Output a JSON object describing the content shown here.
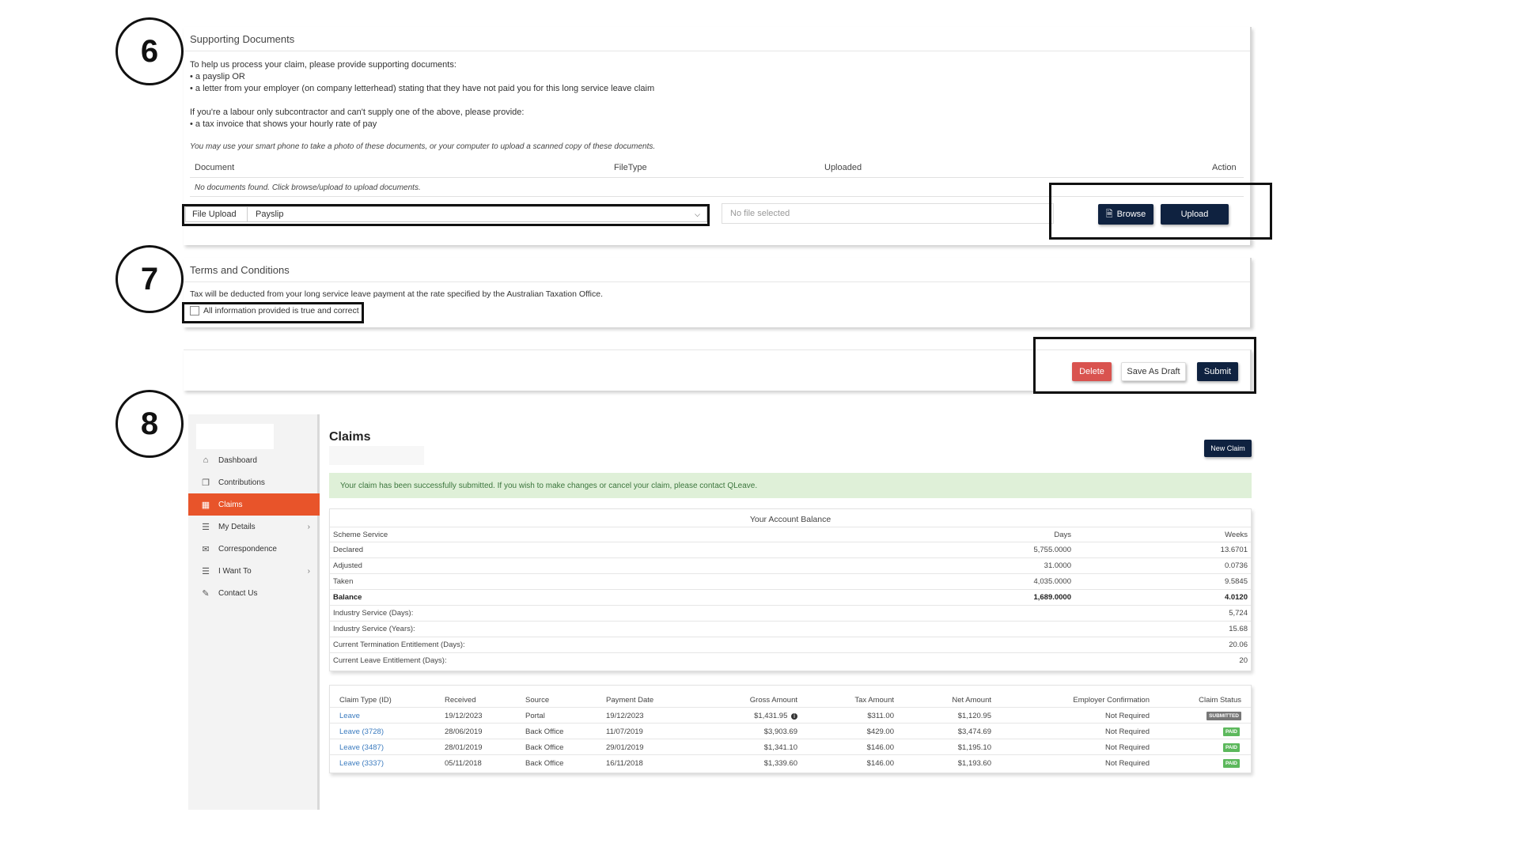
{
  "steps": [
    "6",
    "7",
    "8"
  ],
  "supporting_documents": {
    "title": "Supporting Documents",
    "intro": "To help us process your claim, please provide supporting documents:",
    "bullet1": "• a payslip OR",
    "bullet2": "• a letter from your employer (on company letterhead) stating that they have not paid you for this long service leave claim",
    "subcontractor": "If you're a labour only subcontractor and can't supply one of the above, please provide:",
    "bullet3": "• a tax invoice that shows your hourly rate of pay",
    "phone_note": "You may use your smart phone to take a photo of these documents, or your computer to upload a scanned copy of these documents.",
    "col_document": "Document",
    "col_filetype": "FileType",
    "col_uploaded": "Uploaded",
    "col_action": "Action",
    "empty": "No documents found. Click browse/upload to upload documents.",
    "file_upload_label": "File Upload",
    "file_type_selected": "Payslip",
    "no_file": "No file selected",
    "browse": "Browse",
    "upload": "Upload"
  },
  "terms": {
    "title": "Terms and Conditions",
    "text": "Tax will be deducted from your long service leave payment at the rate specified by the Australian Taxation Office.",
    "checkbox_label": "All information provided is true and correct"
  },
  "actions": {
    "delete": "Delete",
    "save_draft": "Save As Draft",
    "submit": "Submit"
  },
  "sidebar": {
    "items": [
      {
        "label": "Dashboard",
        "icon": "home-icon"
      },
      {
        "label": "Contributions",
        "icon": "copy-icon"
      },
      {
        "label": "Claims",
        "icon": "claims-icon"
      },
      {
        "label": "My Details",
        "icon": "list-icon"
      },
      {
        "label": "Correspondence",
        "icon": "envelope-icon"
      },
      {
        "label": "I Want To",
        "icon": "list-icon"
      },
      {
        "label": "Contact Us",
        "icon": "pencil-icon"
      }
    ]
  },
  "claims_page": {
    "title": "Claims",
    "new_claim": "New Claim",
    "success": "Your claim has been successfully submitted. If you wish to make changes or cancel your claim, please contact QLeave."
  },
  "balance": {
    "title": "Your Account Balance",
    "header": {
      "label": "Scheme Service",
      "days": "Days",
      "weeks": "Weeks"
    },
    "rows": [
      {
        "label": "Declared",
        "days": "5,755.0000",
        "weeks": "13.6701"
      },
      {
        "label": "Adjusted",
        "days": "31.0000",
        "weeks": "0.0736"
      },
      {
        "label": "Taken",
        "days": "4,035.0000",
        "weeks": "9.5845"
      },
      {
        "label": "Balance",
        "days": "1,689.0000",
        "weeks": "4.0120"
      }
    ],
    "extra": [
      {
        "label": "Industry Service (Days):",
        "value": "5,724"
      },
      {
        "label": "Industry Service (Years):",
        "value": "15.68"
      },
      {
        "label": "Current Termination Entitlement (Days):",
        "value": "20.06"
      },
      {
        "label": "Current Leave Entitlement (Days):",
        "value": "20"
      }
    ]
  },
  "claims_table": {
    "headers": {
      "type": "Claim Type (ID)",
      "received": "Received",
      "source": "Source",
      "payment": "Payment Date",
      "gross": "Gross Amount",
      "tax": "Tax Amount",
      "net": "Net Amount",
      "employer": "Employer Confirmation",
      "status": "Claim Status"
    },
    "rows": [
      {
        "type": "Leave",
        "received": "19/12/2023",
        "source": "Portal",
        "payment": "19/12/2023",
        "gross": "$1,431.95",
        "tax": "$311.00",
        "net": "$1,120.95",
        "employer": "Not Required",
        "status": "SUBMITTED"
      },
      {
        "type": "Leave (3728)",
        "received": "28/06/2019",
        "source": "Back Office",
        "payment": "11/07/2019",
        "gross": "$3,903.69",
        "tax": "$429.00",
        "net": "$3,474.69",
        "employer": "Not Required",
        "status": "PAID"
      },
      {
        "type": "Leave (3487)",
        "received": "28/01/2019",
        "source": "Back Office",
        "payment": "29/01/2019",
        "gross": "$1,341.10",
        "tax": "$146.00",
        "net": "$1,195.10",
        "employer": "Not Required",
        "status": "PAID"
      },
      {
        "type": "Leave (3337)",
        "received": "05/11/2018",
        "source": "Back Office",
        "payment": "16/11/2018",
        "gross": "$1,339.60",
        "tax": "$146.00",
        "net": "$1,193.60",
        "employer": "Not Required",
        "status": "PAID"
      }
    ]
  }
}
